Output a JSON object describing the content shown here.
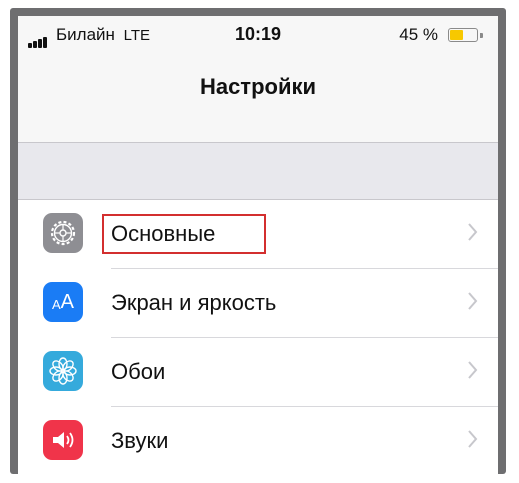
{
  "statusbar": {
    "carrier": "Билайн",
    "network": "LTE",
    "time": "10:19",
    "battery_percent_text": "45 %",
    "battery_level": 0.45,
    "battery_color": "#f7c800"
  },
  "navbar": {
    "title": "Настройки"
  },
  "settings": {
    "items": [
      {
        "label": "Основные",
        "icon": "gear-icon",
        "icon_color": "#8e8e93",
        "highlighted": true
      },
      {
        "label": "Экран и яркость",
        "icon": "text-size-icon",
        "icon_color": "#1a7cf5"
      },
      {
        "label": "Обои",
        "icon": "flower-icon",
        "icon_color": "#35aadc"
      },
      {
        "label": "Звуки",
        "icon": "speaker-icon",
        "icon_color": "#f0344a"
      }
    ]
  },
  "colors": {
    "highlight_border": "#d32f2f"
  }
}
